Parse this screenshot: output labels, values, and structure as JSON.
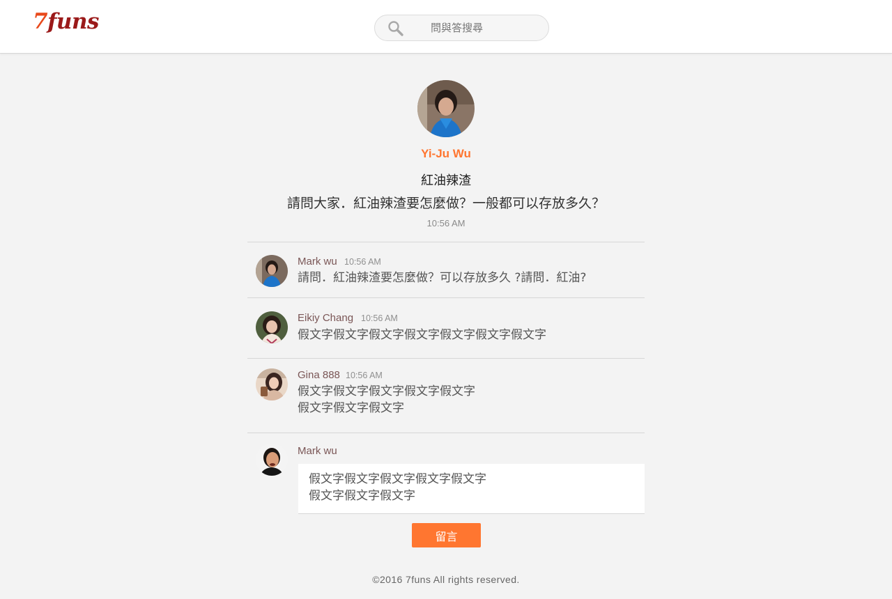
{
  "header": {
    "logo_seven": "7",
    "logo_funs": "funs",
    "search_placeholder": "問與答搜尋"
  },
  "post": {
    "author": "Yi-Ju Wu",
    "title": "紅油辣渣",
    "body": "請問大家．紅油辣渣要怎麼做？一般都可以存放多久？",
    "time": "10:56 AM"
  },
  "comments": [
    {
      "name": "Mark wu",
      "time": "10:56 AM",
      "lines": [
        "請問．紅油辣渣要怎麼做？可以存放多久 ?請問．紅油?"
      ]
    },
    {
      "name": "Eikiy Chang",
      "time": "10:56 AM",
      "lines": [
        "假文字假文字假文字假文字假文字假文字假文字"
      ]
    },
    {
      "name": "Gina 888",
      "time": "10:56 AM",
      "lines": [
        "假文字假文字假文字假文字假文字",
        "假文字假文字假文字"
      ]
    }
  ],
  "compose": {
    "name": "Mark wu",
    "lines": [
      "假文字假文字假文字假文字假文字",
      "假文字假文字假文字"
    ],
    "submit_label": "留言"
  },
  "footer": {
    "copyright": "©2016 7funs All rights reserved."
  },
  "colors": {
    "accent": "#ff7630",
    "logo_dark": "#9b1a1a",
    "name": "#7a5656"
  }
}
